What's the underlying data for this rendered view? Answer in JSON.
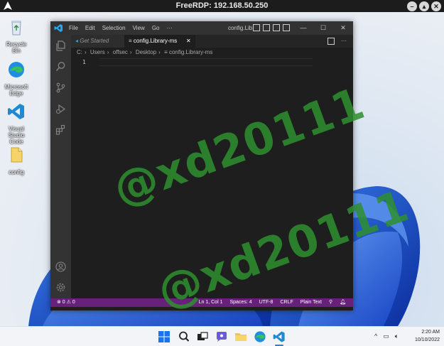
{
  "rdp": {
    "title": "FreeRDP: 192.168.50.250",
    "controls": [
      "minimize-icon",
      "maximize-icon",
      "close-icon"
    ]
  },
  "desktop": {
    "icons": [
      {
        "label": "Recycle Bin",
        "icon": "recycle-bin-icon"
      },
      {
        "label": "Microsoft Edge",
        "icon": "edge-icon"
      },
      {
        "label": "Visual Studio Code",
        "icon": "vscode-icon"
      },
      {
        "label": "config",
        "icon": "file-icon"
      }
    ]
  },
  "vscode": {
    "menu": [
      "File",
      "Edit",
      "Selection",
      "View",
      "Go",
      "···"
    ],
    "window_title": "config.Library-ms - Visual...",
    "tabs": [
      {
        "label": "Get Started",
        "active": false
      },
      {
        "label": "config.Library-ms",
        "active": true
      }
    ],
    "tab_more": "···",
    "breadcrumb": [
      "C:",
      "Users",
      "offsec",
      "Desktop",
      "config.Library-ms"
    ],
    "editor": {
      "line_numbers": [
        "1"
      ]
    },
    "status": {
      "problems": "⊗ 0 ⚠ 0",
      "cursor": "Ln 1, Col 1",
      "spaces": "Spaces: 4",
      "encoding": "UTF-8",
      "eol": "CRLF",
      "language": "Plain Text"
    },
    "colors": {
      "statusbar": "#68217a",
      "editor_bg": "#1e1e1e"
    }
  },
  "watermark": {
    "text": "@xd20111",
    "color": "#2e8f2e"
  },
  "taskbar": {
    "icons": [
      "windows-start-icon",
      "search-icon",
      "task-view-icon",
      "chat-icon",
      "file-explorer-icon",
      "edge-icon",
      "vscode-icon"
    ],
    "time": "2:20 AM",
    "date": "10/10/2022"
  }
}
